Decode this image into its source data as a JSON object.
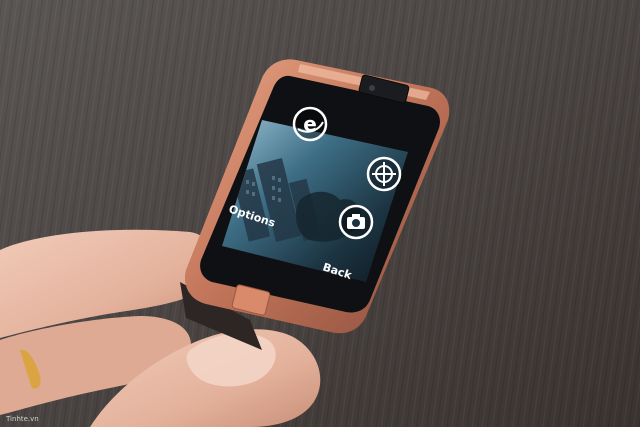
{
  "watch_screen": {
    "options_label": "Options",
    "back_label": "Back",
    "icons": [
      "browser-e-icon",
      "compass-globe-icon",
      "camera-icon"
    ]
  },
  "watermark": "Tinhte.vn",
  "colors": {
    "case": "#c0735a",
    "case_highlight": "#e6a183",
    "screen_bg": "#0e0f12",
    "table_wood": "#56504e"
  }
}
